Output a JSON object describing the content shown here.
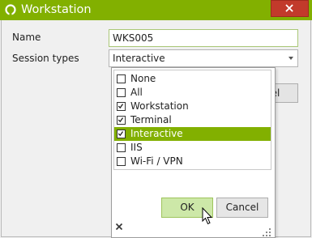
{
  "window": {
    "title": "Workstation",
    "accent_color": "#82b000",
    "close_icon": "close-icon"
  },
  "form": {
    "name_label": "Name",
    "name_value": "WKS005",
    "session_types_label": "Session types",
    "session_types_value": "Interactive"
  },
  "background_button": {
    "visible_label": "cel"
  },
  "dropdown": {
    "options": [
      {
        "label": "None",
        "checked": false,
        "selected": false
      },
      {
        "label": "All",
        "checked": false,
        "selected": false
      },
      {
        "label": "Workstation",
        "checked": true,
        "selected": false
      },
      {
        "label": "Terminal",
        "checked": true,
        "selected": false
      },
      {
        "label": "Interactive",
        "checked": true,
        "selected": true
      },
      {
        "label": "IIS",
        "checked": false,
        "selected": false
      },
      {
        "label": "Wi-Fi / VPN",
        "checked": false,
        "selected": false
      }
    ],
    "ok_label": "OK",
    "cancel_label": "Cancel",
    "clear_icon": "x-icon",
    "resize_icon": "resize-grip-icon"
  }
}
